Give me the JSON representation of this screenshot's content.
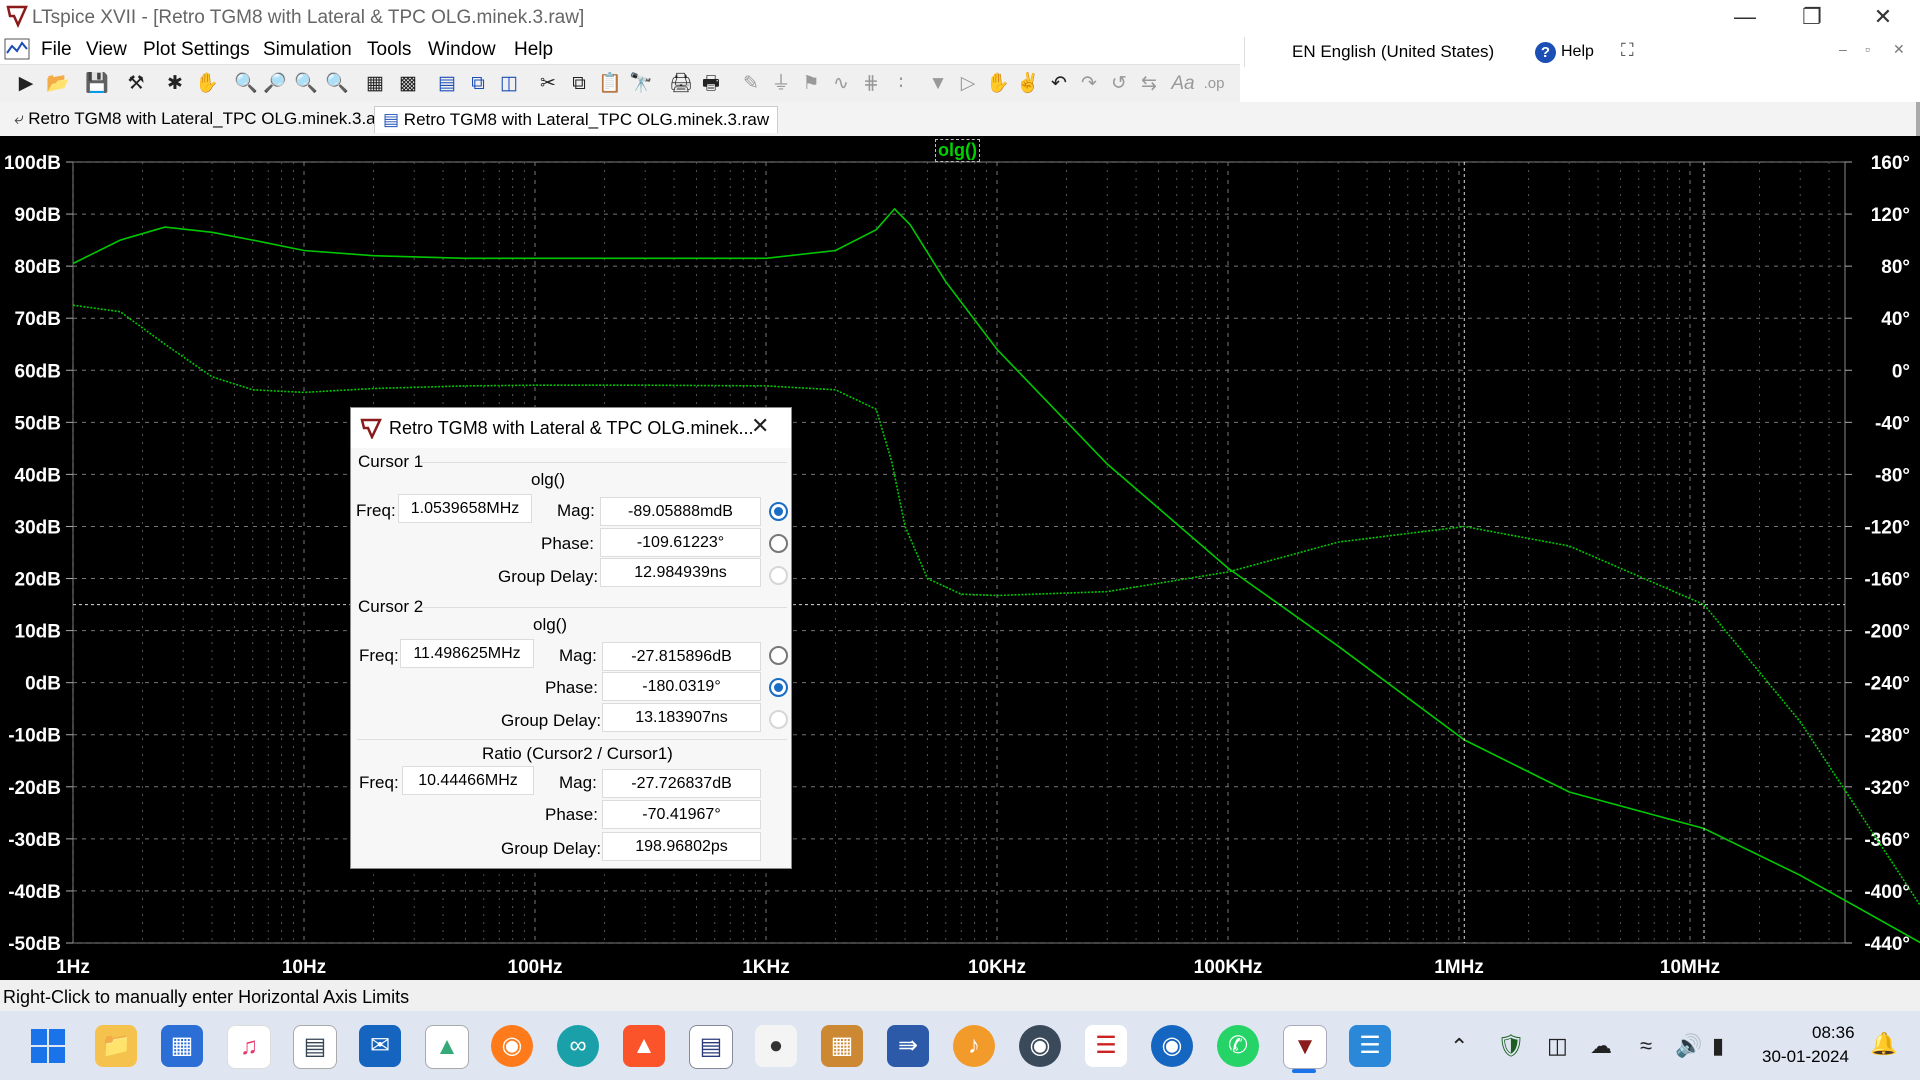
{
  "window": {
    "title": "LTspice XVII - [Retro TGM8 with Lateral & TPC OLG.minek.3.raw]"
  },
  "menu": [
    "File",
    "View",
    "Plot Settings",
    "Simulation",
    "Tools",
    "Window",
    "Help"
  ],
  "language_bar": {
    "language": "EN English (United States)",
    "help": "Help"
  },
  "tabs": [
    {
      "label": "Retro TGM8 with Lateral_TPC OLG.minek.3.asc"
    },
    {
      "label": "Retro TGM8 with Lateral_TPC OLG.minek.3.raw"
    }
  ],
  "plot": {
    "trace_label": "olg()",
    "left_ticks": [
      "100dB",
      "90dB",
      "80dB",
      "70dB",
      "60dB",
      "50dB",
      "40dB",
      "30dB",
      "20dB",
      "10dB",
      "0dB",
      "-10dB",
      "-20dB",
      "-30dB",
      "-40dB",
      "-50dB"
    ],
    "right_ticks": [
      "160°",
      "120°",
      "80°",
      "40°",
      "0°",
      "-40°",
      "-80°",
      "-120°",
      "-160°",
      "-200°",
      "-240°",
      "-280°",
      "-320°",
      "-360°",
      "-400°",
      "-440°"
    ],
    "x_ticks": [
      "1Hz",
      "10Hz",
      "100Hz",
      "1KHz",
      "10KHz",
      "100KHz",
      "1MHz",
      "10MHz"
    ],
    "trace_color": "#00c800",
    "cursor1_freq_hz": 1053965.8,
    "cursor2_freq_hz": 11498625,
    "cursor_phase_deg": -180.0319
  },
  "chart_data": {
    "type": "line",
    "x_scale": "log",
    "xlim_hz": [
      1,
      150000000
    ],
    "ylim_db": [
      -50,
      100
    ],
    "ylim_deg": [
      -440,
      160
    ],
    "series": [
      {
        "name": "olg()",
        "axis": "magnitude_dB",
        "x": [
          1,
          1.6,
          2.5,
          4,
          6,
          10,
          20,
          50,
          100,
          300,
          1000,
          2000,
          3000,
          3600,
          4200,
          6000,
          10000,
          30000,
          100000,
          300000,
          1053966,
          3000000,
          11498625,
          30000000,
          100000000
        ],
        "values": [
          80.5,
          85,
          87.5,
          86.5,
          85,
          83,
          82,
          81.5,
          81.5,
          81.5,
          81.5,
          83,
          87,
          91,
          88,
          77,
          64,
          42,
          22,
          7,
          -11,
          -21,
          -28,
          -37,
          -50
        ]
      },
      {
        "name": "olg()",
        "axis": "phase_deg",
        "x": [
          1,
          1.6,
          2.5,
          4,
          6,
          10,
          20,
          50,
          100,
          300,
          1000,
          2000,
          3000,
          3500,
          4000,
          5000,
          7000,
          10000,
          30000,
          100000,
          300000,
          1053966,
          3000000,
          11498625,
          30000000,
          100000000
        ],
        "values": [
          50,
          45,
          20,
          -5,
          -15,
          -17,
          -14,
          -12,
          -11.5,
          -11.5,
          -12,
          -15,
          -30,
          -70,
          -120,
          -160,
          -172,
          -173,
          -170,
          -155,
          -132,
          -120,
          -135,
          -180,
          -270,
          -412
        ]
      }
    ]
  },
  "dialog": {
    "title": "Retro TGM8 with Lateral & TPC OLG.minek...",
    "cursor1": {
      "header": "Cursor 1",
      "trace": "olg()",
      "freq_label": "Freq:",
      "freq": "1.0539658MHz",
      "mag_label": "Mag:",
      "mag": "-89.05888mdB",
      "phase_label": "Phase:",
      "phase": "-109.61223°",
      "gd_label": "Group Delay:",
      "gd": "12.984939ns",
      "selected": "Mag"
    },
    "cursor2": {
      "header": "Cursor 2",
      "trace": "olg()",
      "freq_label": "Freq:",
      "freq": "11.498625MHz",
      "mag_label": "Mag:",
      "mag": "-27.815896dB",
      "phase_label": "Phase:",
      "phase": "-180.0319°",
      "gd_label": "Group Delay:",
      "gd": "13.183907ns",
      "selected": "Phase"
    },
    "ratio": {
      "header": "Ratio (Cursor2 / Cursor1)",
      "freq_label": "Freq:",
      "freq": "10.44466MHz",
      "mag_label": "Mag:",
      "mag": "-27.726837dB",
      "phase_label": "Phase:",
      "phase": "-70.41967°",
      "gd_label": "Group Delay:",
      "gd": "198.96802ps"
    }
  },
  "status": {
    "text": "Right-Click to manually enter Horizontal Axis Limits"
  },
  "taskbar": {
    "time": "08:36",
    "date": "30-01-2024"
  }
}
